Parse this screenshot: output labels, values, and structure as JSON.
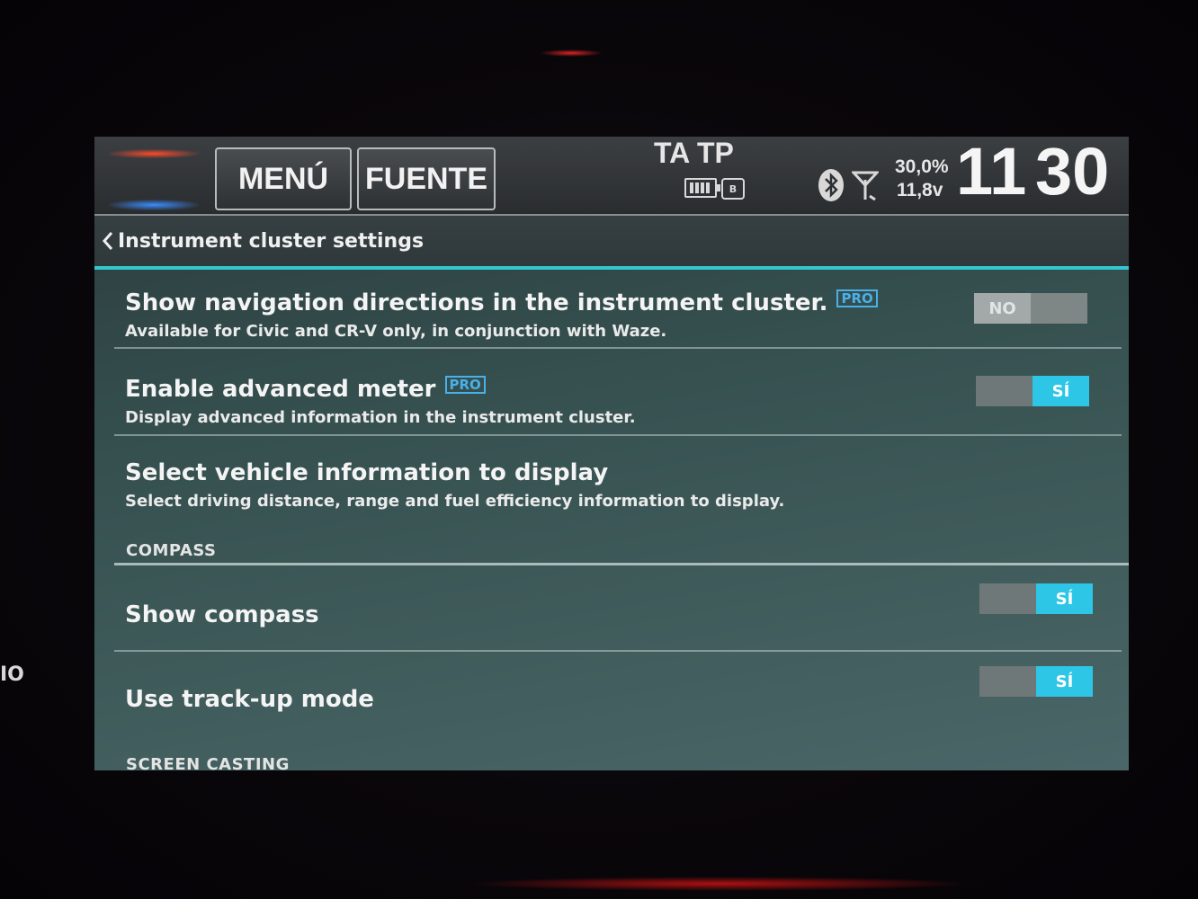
{
  "topbar": {
    "menu_label": "MENÚ",
    "fuente_label": "FUENTE",
    "ta_tp": "TA TP",
    "media_label": "B",
    "voltage_percent": "30,0%",
    "voltage_value": "11,8v",
    "clock_hour": "11",
    "clock_minute": "30"
  },
  "breadcrumb": {
    "title": "Instrument cluster settings"
  },
  "settings": [
    {
      "title": "Show navigation directions in the instrument cluster.",
      "pro": "PRO",
      "subtitle": "Available for Civic and CR-V only, in conjunction with Waze.",
      "toggle_label": "NO",
      "toggle_on": false
    },
    {
      "title": "Enable advanced meter",
      "pro": "PRO",
      "subtitle": "Display advanced information in the instrument cluster.",
      "toggle_label": "SÍ",
      "toggle_on": true
    },
    {
      "title": "Select vehicle information to display",
      "subtitle": "Select driving distance, range and fuel efficiency information to display."
    }
  ],
  "compass_section": {
    "label": "COMPASS",
    "items": [
      {
        "title": "Show compass",
        "toggle_label": "SÍ",
        "toggle_on": true
      },
      {
        "title": "Use track-up mode",
        "toggle_label": "SÍ",
        "toggle_on": true
      }
    ]
  },
  "screen_casting_section": {
    "label": "SCREEN CASTING"
  },
  "bezel": {
    "side_text": "IO"
  },
  "colors": {
    "accent": "#33c6d0",
    "toggle_on": "#2ec6e6",
    "pro_badge": "#4ab0e8"
  }
}
